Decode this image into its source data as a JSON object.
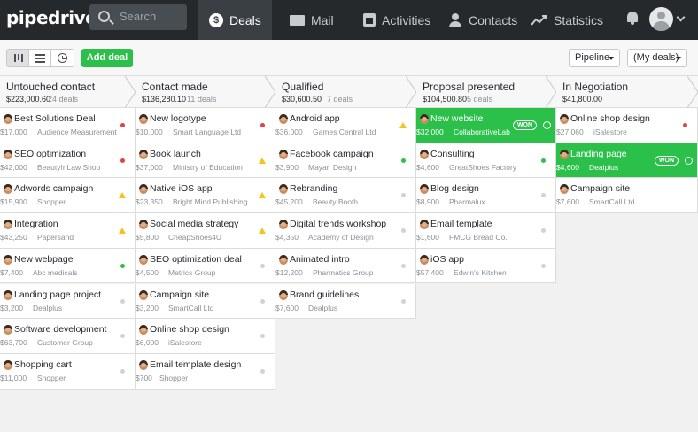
{
  "nav": {
    "logo": "pipedrive",
    "search_placeholder": "Search",
    "items": [
      {
        "label": "Deals",
        "icon": "dollar-icon",
        "active": true
      },
      {
        "label": "Mail",
        "icon": "mail-icon"
      },
      {
        "label": "Activities",
        "icon": "calendar-icon"
      },
      {
        "label": "Contacts",
        "icon": "person-icon"
      },
      {
        "label": "Statistics",
        "icon": "chart-icon"
      }
    ]
  },
  "toolbar": {
    "view_buttons": [
      "pipeline-view-icon",
      "list-view-icon",
      "timeline-view-icon"
    ],
    "add_deal": "Add deal",
    "pipeline_dropdown": "Pipeline",
    "filter_dropdown": "(My deals)"
  },
  "won_label": "WON",
  "colors": {
    "won": "#2bc04a",
    "alert": "#e2433e",
    "warning": "#f5c418",
    "ok": "#2bc04a",
    "idle": "#d0d3d6"
  },
  "stages": [
    {
      "name": "Untouched contact",
      "value": "$223,000.60",
      "count": "24 deals",
      "deals": [
        {
          "title": "Best Solutions Deal",
          "value": "$17,000",
          "org": "Audience Measurement",
          "status": "red"
        },
        {
          "title": "SEO optimization",
          "value": "$42,000",
          "org": "BeautyInLaw Shop",
          "status": "red"
        },
        {
          "title": "Adwords campaign",
          "value": "$15,900",
          "org": "Shopper",
          "status": "warn"
        },
        {
          "title": "Integration",
          "value": "$43,250",
          "org": "Papersand",
          "status": "warn"
        },
        {
          "title": "New webpage",
          "value": "$7,400",
          "org": "Abc medicals",
          "status": "green"
        },
        {
          "title": "Landing page project",
          "value": "$3,200",
          "org": "Dealplus",
          "status": "grey"
        },
        {
          "title": "Software development",
          "value": "$63,700",
          "org": "Customer Group",
          "status": "grey"
        },
        {
          "title": "Shopping cart",
          "value": "$11,000",
          "org": "Shopper",
          "status": "grey"
        }
      ]
    },
    {
      "name": "Contact made",
      "value": "$136,280.10",
      "count": "11 deals",
      "deals": [
        {
          "title": "New logotype",
          "value": "$10,000",
          "org": "Smart Language Ltd",
          "status": "red"
        },
        {
          "title": "Book launch",
          "value": "$37,000",
          "org": "Ministry of Education",
          "status": "warn"
        },
        {
          "title": "Native iOS app",
          "value": "$23,350",
          "org": "Bright Mind Publishing",
          "status": "warn"
        },
        {
          "title": "Social media strategy",
          "value": "$5,800",
          "org": "CheapShoes4U",
          "status": "warn"
        },
        {
          "title": "SEO optimization deal",
          "value": "$4,500",
          "org": "Metrics Group",
          "status": "grey"
        },
        {
          "title": "Campaign site",
          "value": "$3,200",
          "org": "SmartCall Ltd",
          "status": "grey"
        },
        {
          "title": "Online shop design",
          "value": "$6,000",
          "org": "iSalestore",
          "status": "grey"
        },
        {
          "title": "Email template design",
          "value": "$700",
          "org": "Shopper",
          "status": "grey"
        }
      ]
    },
    {
      "name": "Qualified",
      "value": "$30,600.50",
      "count": "7 deals",
      "deals": [
        {
          "title": "Android app",
          "value": "$36,000",
          "org": "Games Central Ltd",
          "status": "warn"
        },
        {
          "title": "Facebook campaign",
          "value": "$3,900",
          "org": "Mayan Design",
          "status": "green"
        },
        {
          "title": "Rebranding",
          "value": "$45,200",
          "org": "Beauty Booth",
          "status": "grey"
        },
        {
          "title": "Digital trends workshop",
          "value": "$4,350",
          "org": "Academy of Design",
          "status": "grey"
        },
        {
          "title": "Animated intro",
          "value": "$12,200",
          "org": "Pharmatics Group",
          "status": "grey"
        },
        {
          "title": "Brand guidelines",
          "value": "$7,600",
          "org": "Dealplus",
          "status": "grey"
        }
      ]
    },
    {
      "name": "Proposal presented",
      "value": "$104,500.80",
      "count": "5 deals",
      "deals": [
        {
          "title": "New website",
          "value": "$32,000",
          "org": "CollaborativeLab",
          "status": "won"
        },
        {
          "title": "Consulting",
          "value": "$4,600",
          "org": "GreatShoes Factory",
          "status": "green"
        },
        {
          "title": "Blog design",
          "value": "$8,900",
          "org": "Pharmalux",
          "status": "grey"
        },
        {
          "title": "Email template",
          "value": "$1,600",
          "org": "FMCG Bread Co.",
          "status": "grey"
        },
        {
          "title": "iOS app",
          "value": "$57,400",
          "org": "Edwin's Kitchen",
          "status": "grey"
        }
      ]
    },
    {
      "name": "In Negotiation",
      "value": "$41,800.00",
      "count": "",
      "deals": [
        {
          "title": "Online shop design",
          "value": "$27,060",
          "org": "iSalestore",
          "status": "red"
        },
        {
          "title": "Landing page",
          "value": "$4,600",
          "org": "Dealplus",
          "status": "won"
        },
        {
          "title": "Campaign site",
          "value": "$7,600",
          "org": "SmartCall Ltd",
          "status": "none"
        }
      ]
    }
  ]
}
